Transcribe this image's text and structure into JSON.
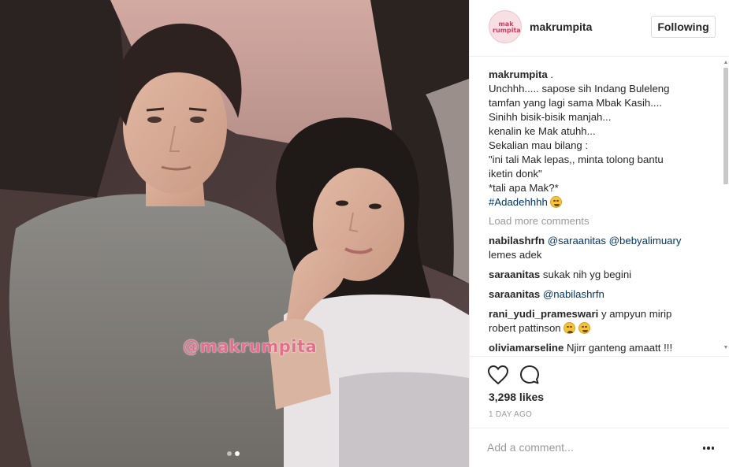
{
  "post": {
    "watermark": "@makrumpita",
    "carousel": {
      "count": 2,
      "active": 2
    }
  },
  "header": {
    "avatar_text": "mak rumpita",
    "username": "makrumpita",
    "follow_label": "Following"
  },
  "caption": {
    "username": "makrumpita",
    "separator": " .",
    "lines": [
      "Unchhh..... sapose sih Indang Buleleng",
      "tamfan yang lagi sama Mbak Kasih....",
      "Sinihh bisik-bisik manjah...",
      "kenalin ke Mak atuhh...",
      "Sekalian mau bilang :",
      "\"ini tali Mak lepas,, minta tolong bantu",
      "iketin donk\"",
      "*tali apa Mak?*"
    ],
    "hashtag": "#Adadehhhh"
  },
  "load_more": "Load more comments",
  "comments": [
    {
      "user": "nabilashrfn",
      "mentions": [
        "@saraanitas",
        "@bebyalimuary"
      ],
      "text": "lemes adek"
    },
    {
      "user": "saraanitas",
      "text": "sukak nih yg begini"
    },
    {
      "user": "saraanitas",
      "mention": "@nabilashrfn"
    },
    {
      "user": "rani_yudi_prameswari",
      "text": "y ampyun mirip",
      "text2": "robert pattinson"
    },
    {
      "user": "oliviamarseline",
      "text": "Njirr ganteng amaatt !!!"
    }
  ],
  "actions": {
    "likes": "3,298 likes",
    "time": "1 DAY AGO"
  },
  "add_comment": {
    "placeholder": "Add a comment..."
  },
  "colors": {
    "link": "#003569",
    "muted": "#999999",
    "watermark": "#e36f8b"
  },
  "icons": [
    "heart-icon",
    "comment-icon",
    "more-options-icon",
    "scroll-up-arrow-icon",
    "scroll-down-arrow-icon"
  ]
}
